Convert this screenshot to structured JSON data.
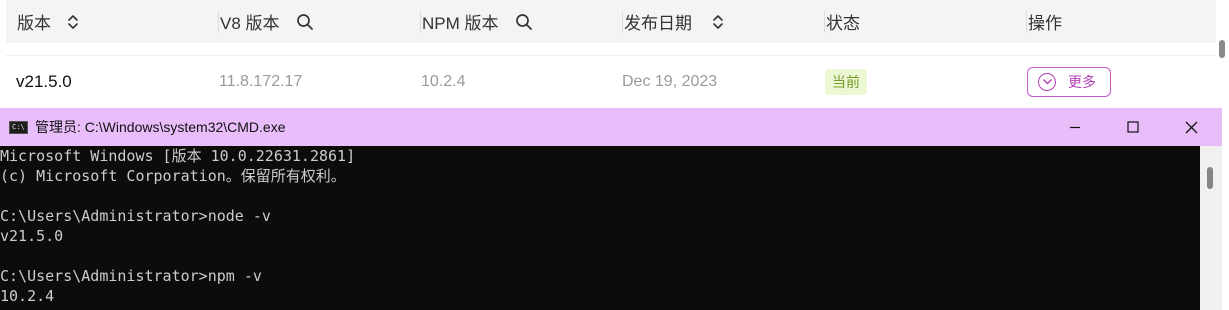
{
  "table": {
    "headers": [
      {
        "label": "版本",
        "icon": "sort-icon"
      },
      {
        "label": "V8 版本",
        "icon": "search-icon"
      },
      {
        "label": "NPM 版本",
        "icon": "search-icon"
      },
      {
        "label": "发布日期",
        "icon": "sort-icon"
      },
      {
        "label": "状态",
        "icon": ""
      },
      {
        "label": "操作",
        "icon": ""
      }
    ],
    "row": {
      "version": "v21.5.0",
      "v8": "11.8.172.17",
      "npm": "10.2.4",
      "date": "Dec 19, 2023",
      "status": "当前",
      "action": "更多"
    }
  },
  "cmd": {
    "title": "管理员: C:\\Windows\\system32\\CMD.exe",
    "icon_text": "C:\\",
    "lines": [
      "Microsoft Windows [版本 10.0.22631.2861]",
      "(c) Microsoft Corporation。保留所有权利。",
      "",
      "C:\\Users\\Administrator>node -v",
      "v21.5.0",
      "",
      "C:\\Users\\Administrator>npm -v",
      "10.2.4"
    ]
  },
  "colors": {
    "titlebar": "#e8bdfa",
    "console_bg": "#0c0c0c",
    "console_text": "#cccccc",
    "accent": "#b33fba",
    "badge_bg": "#ecf7d6",
    "badge_text": "#7a9c2a"
  }
}
